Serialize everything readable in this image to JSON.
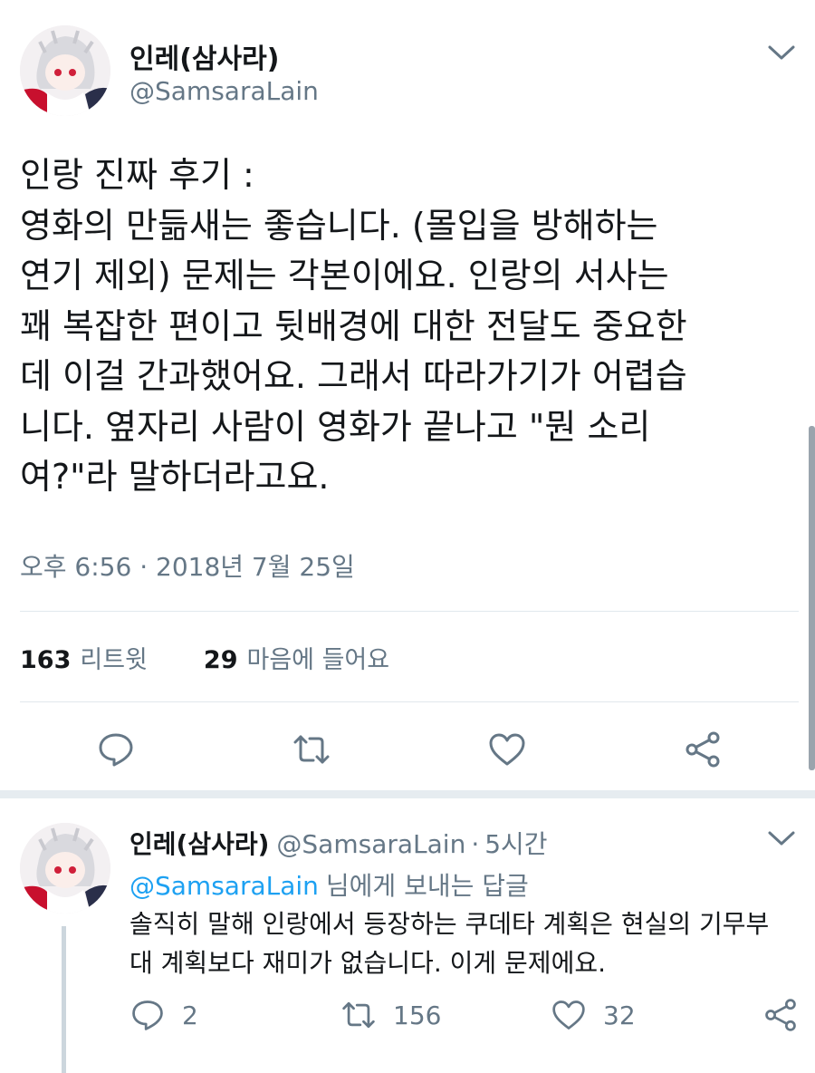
{
  "tweet": {
    "author_name": "인레(삼사라)",
    "author_handle": "@SamsaraLain",
    "text": "인랑 진짜 후기 :\n영화의 만듦새는 좋습니다. (몰입을 방해하는\n연기 제외) 문제는 각본이에요. 인랑의 서사는\n꽤 복잡한 편이고 뒷배경에 대한 전달도 중요한\n데 이걸 간과했어요. 그래서 따라가기가 어렵습\n니다. 옆자리 사람이 영화가 끝나고 \"뭔 소리\n여?\"라 말하더라고요.",
    "timestamp": "오후 6:56 · 2018년 7월 25일",
    "retweet_count": "163",
    "retweet_label": "리트윗",
    "like_count": "29",
    "like_label": "마음에 들어요"
  },
  "reply": {
    "author_name": "인레(삼사라)",
    "author_handle": "@SamsaraLain",
    "separator": "·",
    "time": "5시간",
    "replying_to_handle": "@SamsaraLain",
    "replying_to_suffix": "님에게 보내는 답글",
    "text": "솔직히 말해 인랑에서 등장하는 쿠데타 계획은 현실의 기무부\n대 계획보다 재미가 없습니다. 이게 문제에요.",
    "reply_count": "2",
    "retweet_count": "156",
    "like_count": "32"
  },
  "icons": {
    "menu": "chevron-down-icon",
    "reply": "speech-bubble-icon",
    "retweet": "retweet-arrows-icon",
    "like": "heart-icon",
    "share": "share-icon"
  },
  "colors": {
    "text": "#14171a",
    "secondary": "#657786",
    "link": "#1da1f2",
    "divider": "#e1e8ed"
  }
}
